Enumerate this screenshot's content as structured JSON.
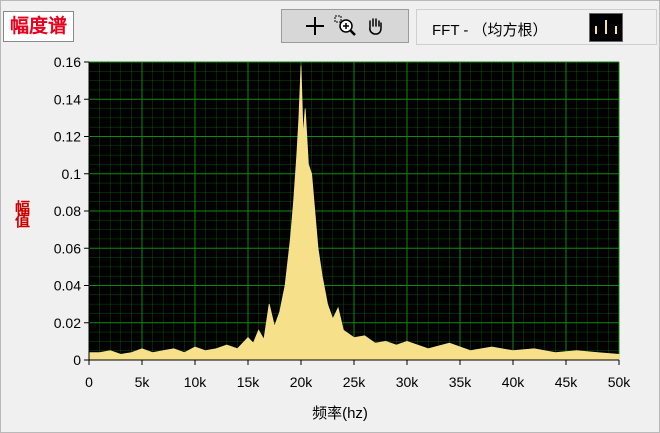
{
  "window": {
    "title": "幅度谱",
    "legend_label": "FFT - （均方根）"
  },
  "toolbar": {
    "tools": [
      {
        "icon": "crosshair-icon"
      },
      {
        "icon": "zoom-icon"
      },
      {
        "icon": "hand-pan-icon"
      }
    ]
  },
  "colors": {
    "plot_background": "#000000",
    "grid": "#0e8a0e",
    "trace": "#f7e08a",
    "title_text": "#e8001c",
    "ylabel_text": "#cc0000"
  },
  "chart_data": {
    "type": "area",
    "xlabel": "频率(hz)",
    "ylabel": "幅值",
    "xlim": [
      0,
      50000
    ],
    "ylim": [
      0,
      0.16
    ],
    "grid": true,
    "xticks": [
      0,
      5000,
      10000,
      15000,
      20000,
      25000,
      30000,
      35000,
      40000,
      45000,
      50000
    ],
    "xtick_labels": [
      "0",
      "5k",
      "10k",
      "15k",
      "20k",
      "25k",
      "30k",
      "35k",
      "40k",
      "45k",
      "50k"
    ],
    "yticks": [
      0,
      0.02,
      0.04,
      0.06,
      0.08,
      0.1,
      0.12,
      0.14,
      0.16
    ],
    "ytick_labels": [
      "0",
      "0.02",
      "0.04",
      "0.06",
      "0.08",
      "0.1",
      "0.12",
      "0.14",
      "0.16"
    ],
    "series": [
      {
        "x": [
          0,
          1000,
          2000,
          3000,
          4000,
          5000,
          6000,
          7000,
          8000,
          9000,
          10000,
          11000,
          12000,
          13000,
          14000,
          15000,
          15500,
          16000,
          16500,
          17000,
          17500,
          18000,
          18500,
          19000,
          19300,
          19600,
          19800,
          20000,
          20200,
          20400,
          20700,
          21000,
          21300,
          21600,
          22000,
          22500,
          23000,
          23500,
          24000,
          25000,
          26000,
          27000,
          28000,
          29000,
          30000,
          32000,
          34000,
          36000,
          38000,
          40000,
          42000,
          44000,
          46000,
          48000,
          50000
        ],
        "y": [
          0.004,
          0.004,
          0.005,
          0.003,
          0.004,
          0.006,
          0.004,
          0.005,
          0.006,
          0.004,
          0.007,
          0.005,
          0.006,
          0.008,
          0.006,
          0.012,
          0.009,
          0.016,
          0.011,
          0.03,
          0.018,
          0.026,
          0.04,
          0.065,
          0.085,
          0.11,
          0.13,
          0.158,
          0.12,
          0.135,
          0.105,
          0.1,
          0.08,
          0.06,
          0.045,
          0.03,
          0.022,
          0.028,
          0.016,
          0.012,
          0.013,
          0.009,
          0.01,
          0.008,
          0.01,
          0.006,
          0.009,
          0.005,
          0.007,
          0.005,
          0.006,
          0.004,
          0.005,
          0.004,
          0.003
        ]
      }
    ]
  }
}
